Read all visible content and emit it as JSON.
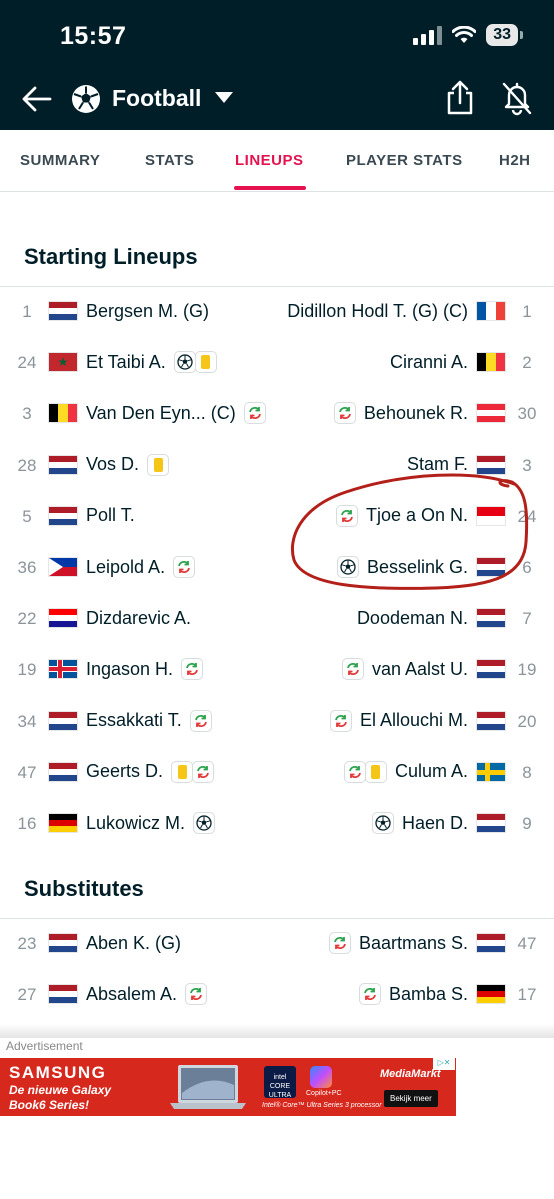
{
  "status": {
    "time": "15:57",
    "battery": "33"
  },
  "header": {
    "title": "Football"
  },
  "tabs": [
    "SUMMARY",
    "STATS",
    "LINEUPS",
    "PLAYER STATS",
    "H2H"
  ],
  "active_tab": "LINEUPS",
  "starting": {
    "title": "Starting Lineups",
    "rows": [
      {
        "home": {
          "num": "1",
          "name": "Bergsen M. (G)",
          "flag": "nl",
          "events": []
        },
        "away": {
          "num": "1",
          "name": "Didillon Hodl T. (G) (C)",
          "flag": "fr",
          "events": []
        }
      },
      {
        "home": {
          "num": "24",
          "name": "Et Taibi A.",
          "flag": "ma",
          "events": [
            [
              "goal",
              "yellow"
            ]
          ]
        },
        "away": {
          "num": "2",
          "name": "Ciranni A.",
          "flag": "be",
          "events": []
        }
      },
      {
        "home": {
          "num": "3",
          "name": "Van Den Eyn... (C)",
          "flag": "be",
          "events": [
            "sub"
          ]
        },
        "away": {
          "num": "30",
          "name": "Behounek R.",
          "flag": "at",
          "events": [
            "sub"
          ]
        }
      },
      {
        "home": {
          "num": "28",
          "name": "Vos D.",
          "flag": "nl",
          "events": [
            "yellow"
          ]
        },
        "away": {
          "num": "3",
          "name": "Stam F.",
          "flag": "nl",
          "events": []
        }
      },
      {
        "home": {
          "num": "5",
          "name": "Poll T.",
          "flag": "nl",
          "events": []
        },
        "away": {
          "num": "24",
          "name": "Tjoe a On N.",
          "flag": "id",
          "events": [
            "sub"
          ]
        }
      },
      {
        "home": {
          "num": "36",
          "name": "Leipold A.",
          "flag": "ph",
          "events": [
            "sub"
          ]
        },
        "away": {
          "num": "6",
          "name": "Besselink G.",
          "flag": "nl",
          "events": [
            "goal"
          ]
        }
      },
      {
        "home": {
          "num": "22",
          "name": "Dizdarevic A.",
          "flag": "hr",
          "events": []
        },
        "away": {
          "num": "7",
          "name": "Doodeman N.",
          "flag": "nl",
          "events": []
        }
      },
      {
        "home": {
          "num": "19",
          "name": "Ingason H.",
          "flag": "is",
          "events": [
            "sub"
          ]
        },
        "away": {
          "num": "19",
          "name": "van Aalst U.",
          "flag": "nl",
          "events": [
            "sub"
          ]
        }
      },
      {
        "home": {
          "num": "34",
          "name": "Essakkati T.",
          "flag": "nl",
          "events": [
            "sub"
          ]
        },
        "away": {
          "num": "20",
          "name": "El Allouchi M.",
          "flag": "nl",
          "events": [
            "sub"
          ]
        }
      },
      {
        "home": {
          "num": "47",
          "name": "Geerts D.",
          "flag": "nl",
          "events": [
            [
              "yellow",
              "sub"
            ]
          ]
        },
        "away": {
          "num": "8",
          "name": "Culum A.",
          "flag": "se",
          "events": [
            [
              "sub",
              "yellow"
            ]
          ]
        }
      },
      {
        "home": {
          "num": "16",
          "name": "Lukowicz M.",
          "flag": "de",
          "events": [
            "goal"
          ]
        },
        "away": {
          "num": "9",
          "name": "Haen D.",
          "flag": "nl",
          "events": [
            "goal"
          ]
        }
      }
    ]
  },
  "substitutes": {
    "title": "Substitutes",
    "rows": [
      {
        "home": {
          "num": "23",
          "name": "Aben K. (G)",
          "flag": "nl",
          "events": []
        },
        "away": {
          "num": "47",
          "name": "Baartmans S.",
          "flag": "nl",
          "events": [
            "sub"
          ]
        }
      },
      {
        "home": {
          "num": "27",
          "name": "Absalem A.",
          "flag": "nl",
          "events": [
            "sub"
          ]
        },
        "away": {
          "num": "17",
          "name": "Bamba S.",
          "flag": "de",
          "events": [
            "sub"
          ]
        }
      }
    ]
  },
  "ad": {
    "label": "Advertisement",
    "brand": "SAMSUNG",
    "text": "De nieuwe Galaxy Book6 Series!",
    "copilot": "Copilot+PC",
    "intel_sub": "Intel® Core™ Ultra Series 3 processor",
    "retailer": "MediaMarkt",
    "cta": "Bekijk meer"
  },
  "colors": {
    "accent": "#e4134f",
    "header_bg": "#001e28",
    "annotation": "#b3201a"
  }
}
